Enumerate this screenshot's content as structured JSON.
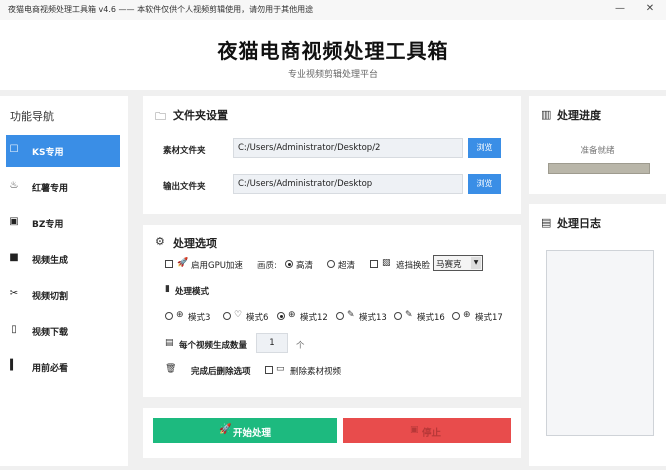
{
  "window": {
    "title": "夜猫电商视频处理工具箱 v4.6 —— 本软件仅供个人视频剪辑使用，请勿用于其他用途",
    "minimize": "—",
    "close": "✕"
  },
  "header": {
    "title": "夜猫电商视频处理工具箱",
    "subtitle": "专业视频剪辑处理平台"
  },
  "sidebar": {
    "title": "功能导航",
    "items": [
      {
        "label": "KS专用",
        "icon": "ks-icon"
      },
      {
        "label": "红薯专用",
        "icon": "redbook-icon"
      },
      {
        "label": "BZ专用",
        "icon": "bilibili-icon"
      },
      {
        "label": "视频生成",
        "icon": "film-icon"
      },
      {
        "label": "视频切割",
        "icon": "scissors-icon"
      },
      {
        "label": "视频下载",
        "icon": "download-icon"
      },
      {
        "label": "用前必看",
        "icon": "info-icon"
      }
    ]
  },
  "folders": {
    "title": "文件夹设置",
    "source_label": "素材文件夹",
    "source_value": "C:/Users/Administrator/Desktop/2",
    "output_label": "输出文件夹",
    "output_value": "C:/Users/Administrator/Desktop",
    "browse": "浏览"
  },
  "options": {
    "title": "处理选项",
    "gpu_label": "启用GPU加速",
    "quality_label": "画质:",
    "quality_high": "高清",
    "quality_ultra": "超清",
    "mask_label": "遮挡换脸",
    "mask_select": "马赛克",
    "mode_title": "处理模式",
    "modes": [
      "模式3",
      "模式6",
      "模式12",
      "模式13",
      "模式16",
      "模式17"
    ],
    "selected_mode": "模式12",
    "count_label": "每个视频生成数量",
    "count_value": "1",
    "count_unit": "个",
    "after_label": "完成后删除选项",
    "delete_label": "删除素材视频"
  },
  "actions": {
    "start": "开始处理",
    "stop": "停止"
  },
  "progress": {
    "title": "处理进度",
    "status": "准备就绪"
  },
  "log": {
    "title": "处理日志"
  },
  "colors": {
    "accent": "#3a8ee6",
    "start": "#1dba7f",
    "stop": "#e84c4c"
  }
}
